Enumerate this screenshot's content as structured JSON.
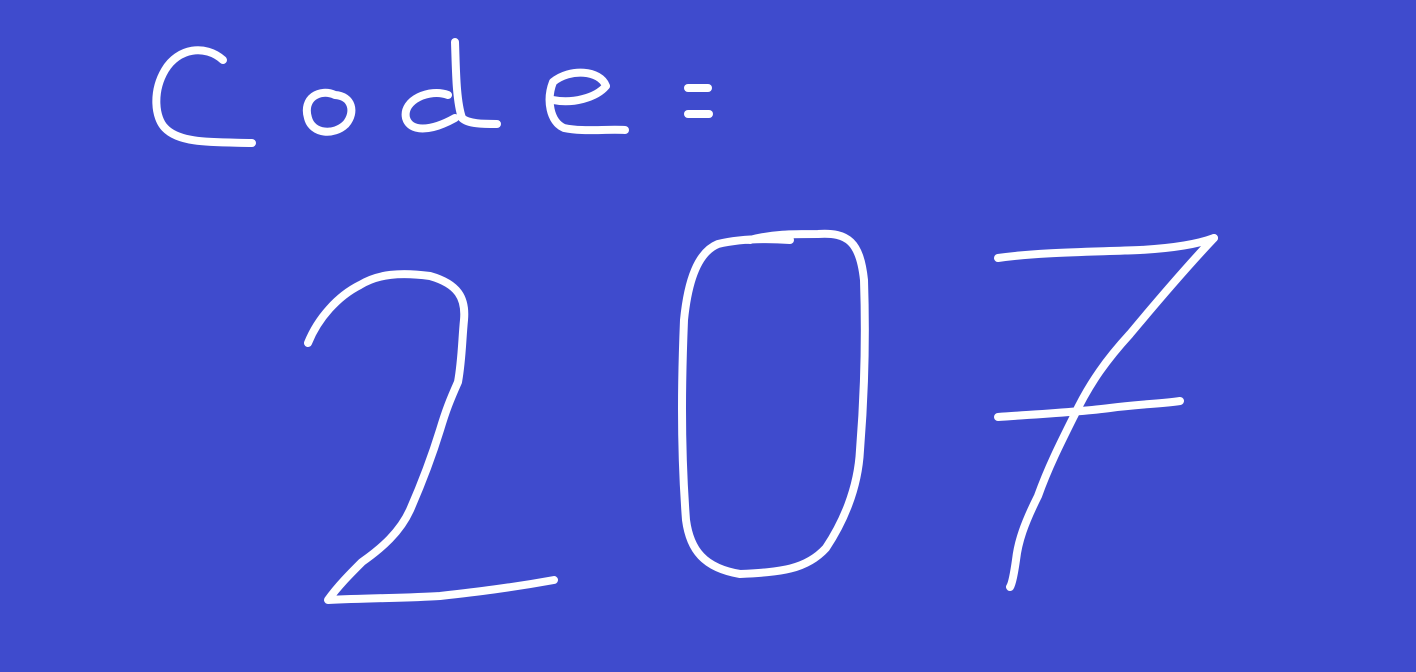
{
  "label": "Code:",
  "code": "207",
  "background_color": "#3f4bcd",
  "ink_color": "#ffffff"
}
